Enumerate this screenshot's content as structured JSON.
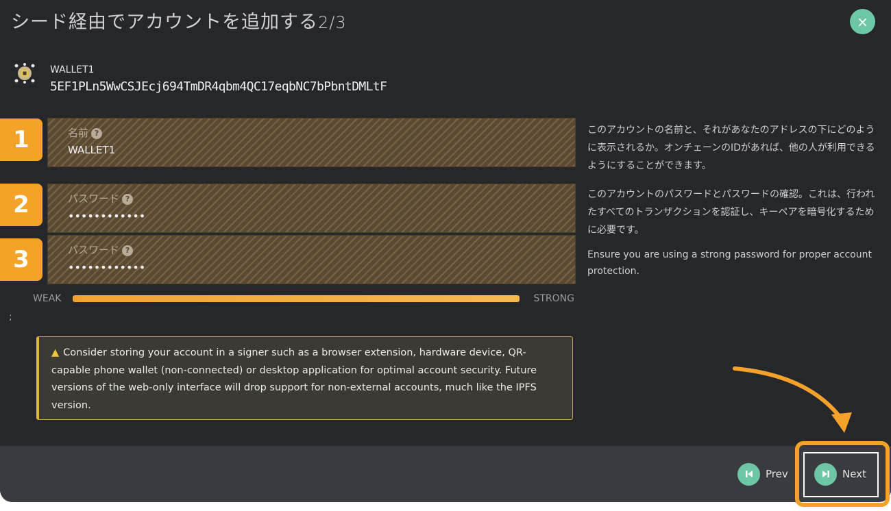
{
  "dialog": {
    "title": "シード経由でアカウントを追加する",
    "step": "2/3",
    "close_symbol": "×"
  },
  "account": {
    "name": "WALLET1",
    "address": "5EF1PLn5WwCSJEcj694TmDR4qbm4QC17eqbNC7bPbntDMLtF"
  },
  "badges": [
    "1",
    "2",
    "3"
  ],
  "fields": {
    "name": {
      "label": "名前",
      "value": "WALLET1"
    },
    "password": {
      "label": "パスワード",
      "value": "••••••••••••"
    },
    "password_confirm": {
      "label": "パスワード",
      "value": "••••••••••••"
    },
    "help_symbol": "?"
  },
  "help": {
    "name": "このアカウントの名前と、それがあなたのアドレスの下にどのように表示されるか。オンチェーンのIDがあれば、他の人が利用できるようにすることができます。",
    "password": "このアカウントのパスワードとパスワードの確認。これは、行われたすべてのトランザクションを認証し、キーペアを暗号化するために必要です。",
    "strong_password": "Ensure you are using a strong password for proper account protection."
  },
  "strength": {
    "weak_label": "WEAK",
    "strong_label": "STRONG",
    "level": 1.0
  },
  "stray_char": ";",
  "warning": {
    "icon": "warning-icon",
    "text": "Consider storing your account in a signer such as a browser extension, hardware device, QR-capable phone wallet (non-connected) or desktop application for optimal account security. Future versions of the web-only interface will drop support for non-external accounts, much like the IPFS version."
  },
  "footer": {
    "prev_label": "Prev",
    "next_label": "Next"
  },
  "colors": {
    "accent": "#6dc6a4",
    "highlight": "#f5a22a",
    "background": "#26272b"
  }
}
